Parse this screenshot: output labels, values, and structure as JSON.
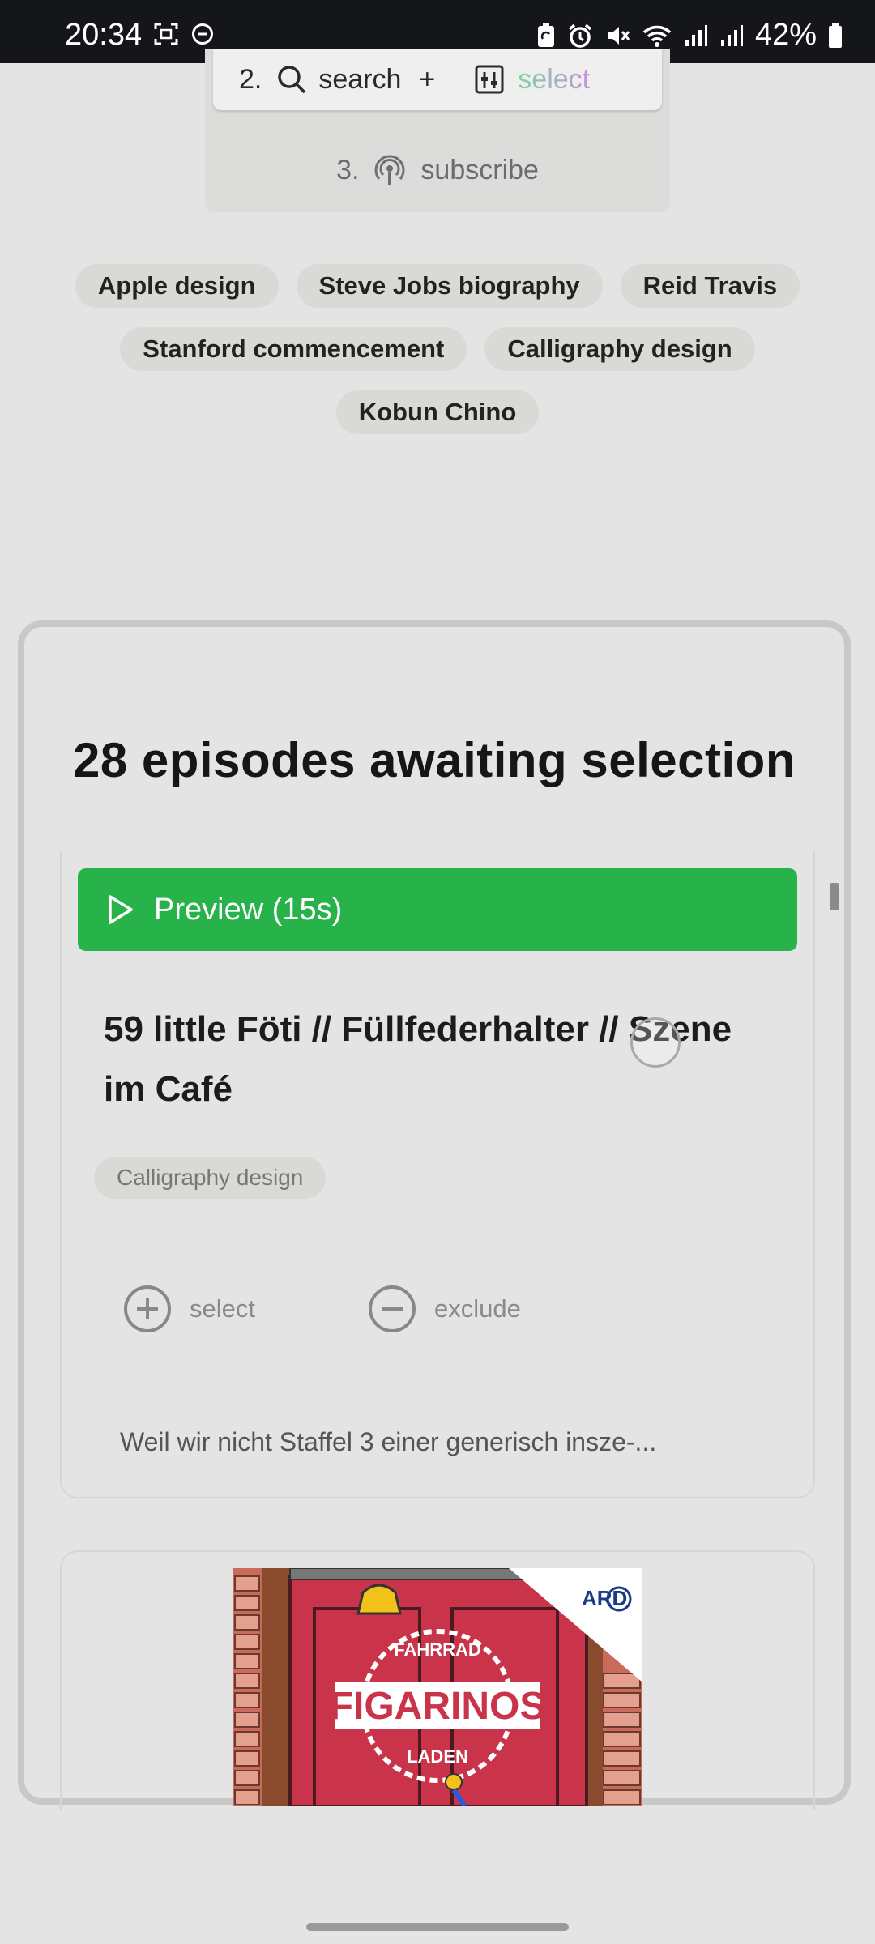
{
  "status_bar": {
    "time": "20:34",
    "battery": "42%",
    "left_icons": [
      "screenshot-icon",
      "do-not-disturb-icon"
    ],
    "right_icons": [
      "battery-saver-icon",
      "alarm-icon",
      "mute-icon",
      "wifi-icon",
      "signal-icon",
      "signal-icon",
      "battery-icon"
    ]
  },
  "steps": {
    "step2": {
      "number": "2.",
      "search_label": "search",
      "plus": "+",
      "select_label": "select"
    },
    "step3": {
      "number": "3.",
      "label": "subscribe"
    }
  },
  "topic_chips": [
    "Apple design",
    "Steve Jobs biography",
    "Reid Travis",
    "Stanford commencement",
    "Calligraphy design",
    "Kobun Chino"
  ],
  "panel": {
    "title": "28 episodes awaiting selection"
  },
  "episode_1": {
    "preview_label": "Preview (15s)",
    "title": "59 little Föti // Füllfederhalter // Szene im Café",
    "tag": "Calligraphy design",
    "select_label": "select",
    "exclude_label": "exclude",
    "description": "Weil wir nicht Staffel 3 einer generisch insze-..."
  },
  "episode_2": {
    "cover_brand": "ARD",
    "cover_title": "FIGARINOS",
    "cover_top_text": "FAHRRAD",
    "cover_bottom_text": "LADEN"
  },
  "colors": {
    "preview_green": "#27b24a",
    "background": "#e4e4e4",
    "cover_red": "#c9344a"
  }
}
